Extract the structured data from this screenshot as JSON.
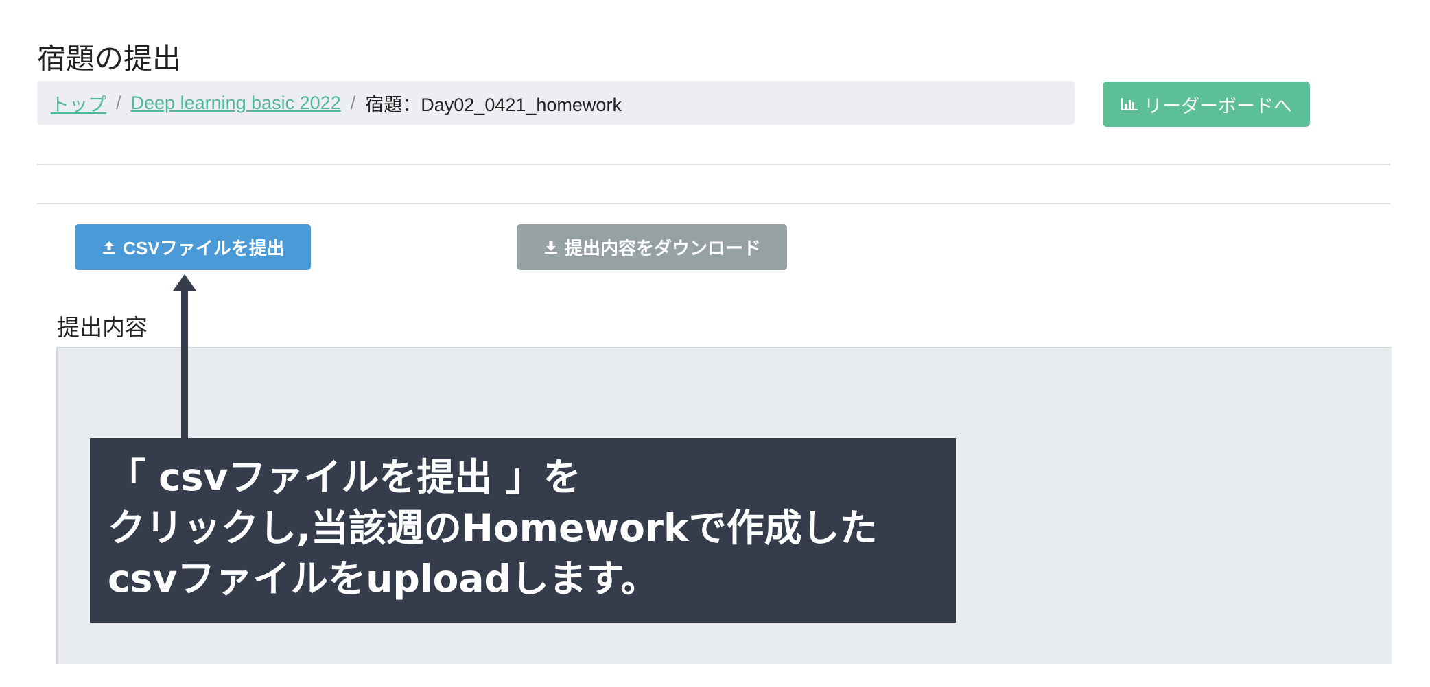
{
  "page": {
    "title": "宿題の提出"
  },
  "breadcrumb": {
    "home": "トップ",
    "course": "Deep learning basic 2022",
    "current": "宿題：Day02_0421_homework",
    "separator": "/"
  },
  "leaderboard_button": {
    "label": "リーダーボードへ",
    "icon": "bar-chart-icon"
  },
  "actions": {
    "upload_label": "CSVファイルを提出",
    "upload_icon": "upload-icon",
    "download_label": "提出内容をダウンロード",
    "download_icon": "download-icon"
  },
  "submission": {
    "label": "提出内容"
  },
  "annotation": {
    "line1": "「 csvファイルを提出 」を",
    "line2": "クリックし,当該週のHomeworkで作成した",
    "line3": "csvファイルをuploadします。"
  },
  "colors": {
    "primary": "#4b9ad8",
    "success": "#5cbf97",
    "secondary": "#96a1a3",
    "callout_bg": "#353c4b",
    "link": "#4fb896"
  }
}
